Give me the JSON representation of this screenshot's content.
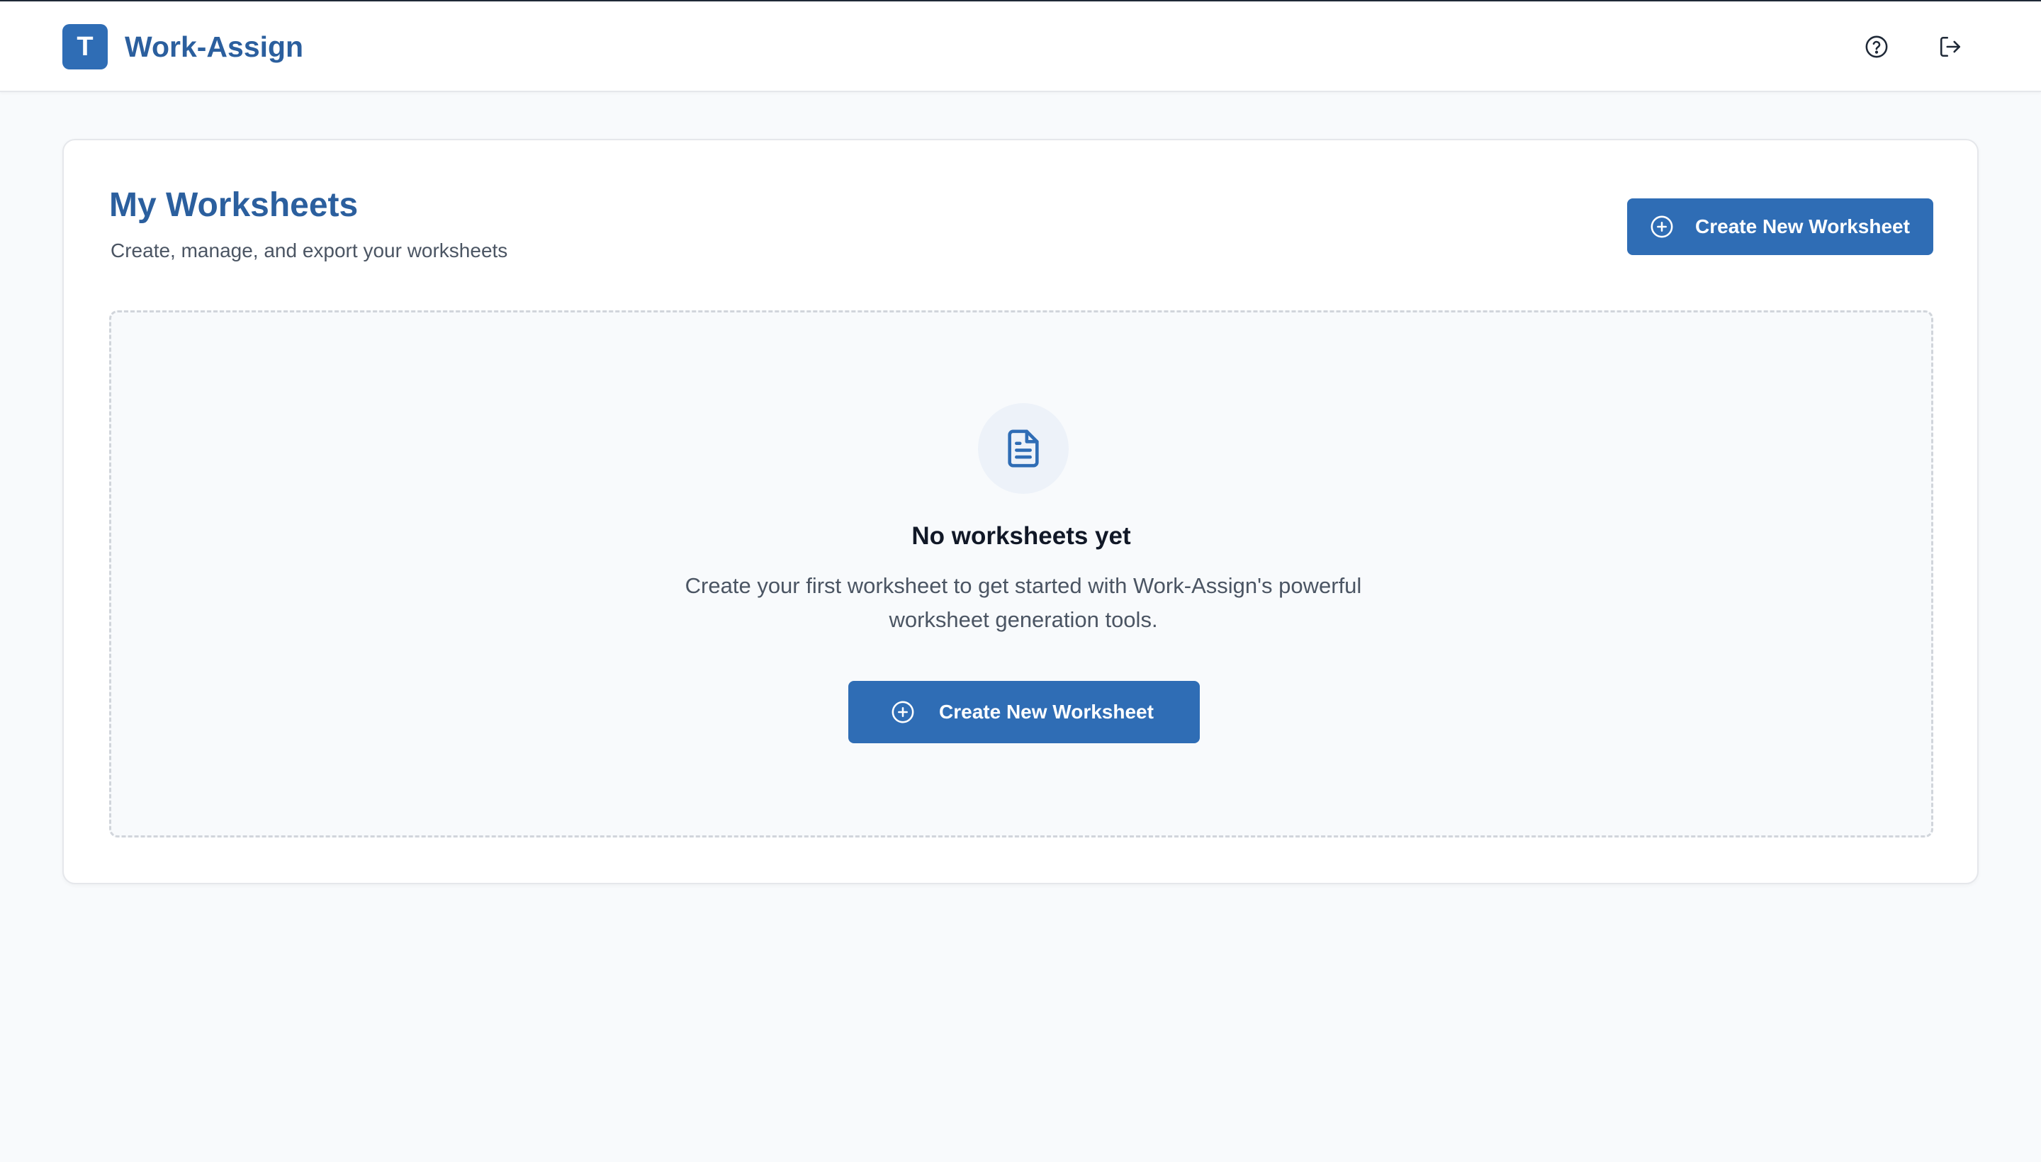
{
  "app": {
    "logo_letter": "T",
    "name": "Work-Assign"
  },
  "header": {
    "help_icon": "help-circle-icon",
    "logout_icon": "logout-icon"
  },
  "page": {
    "title": "My Worksheets",
    "subtitle": "Create, manage, and export your worksheets",
    "create_button_label": "Create New Worksheet",
    "create_button_icon": "plus-circle-icon"
  },
  "empty_state": {
    "icon": "document-icon",
    "title": "No worksheets yet",
    "description": "Create your first worksheet to get started with Work-Assign's powerful worksheet generation tools.",
    "button_label": "Create New Worksheet",
    "button_icon": "plus-circle-icon"
  },
  "colors": {
    "brand": "#2f6db5",
    "title": "#2b5f9e",
    "background": "#f8fafc"
  }
}
